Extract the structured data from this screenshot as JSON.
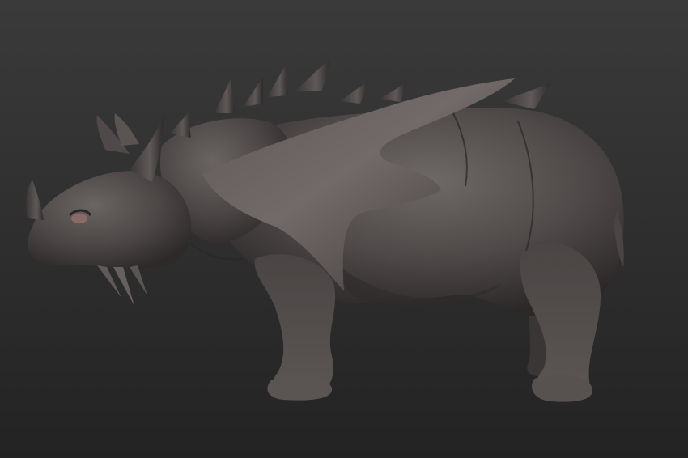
{
  "scene": {
    "subject": "rhino-creature-sculpt",
    "colors": {
      "background_top": "#3a3a3a",
      "background_bottom": "#232323",
      "clay_light": "#6e6866",
      "clay_mid": "#4f4a49",
      "clay_dark": "#2c2828",
      "eye": "#8a6a66"
    }
  }
}
